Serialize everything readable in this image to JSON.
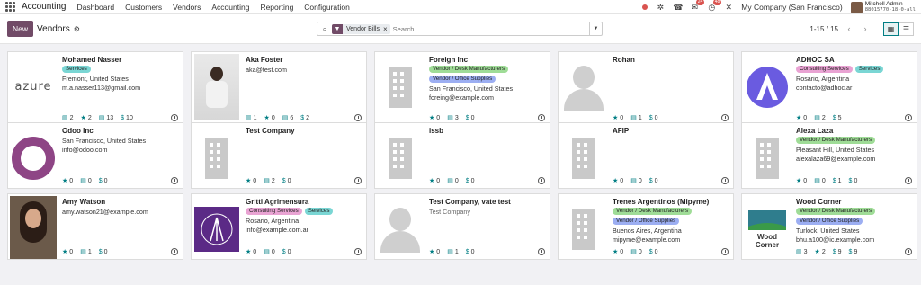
{
  "app": {
    "title": "Accounting"
  },
  "nav": [
    "Dashboard",
    "Customers",
    "Vendors",
    "Accounting",
    "Reporting",
    "Configuration"
  ],
  "systray": {
    "activity_count": "24",
    "chat_count": "48",
    "company": "My Company (San Francisco)",
    "user": "Mitchell Admin",
    "db": "88015770-18-0-all"
  },
  "control": {
    "new_label": "New",
    "breadcrumb": "Vendors",
    "facet": "Vendor Bills",
    "search_placeholder": "Search...",
    "pager": "1-15 / 15"
  },
  "colors": {
    "brand": "#714b67",
    "accent": "#017e84"
  },
  "cards": [
    {
      "name": "Mohamed Nasser",
      "tags": [
        {
          "t": "Services",
          "c": "services"
        }
      ],
      "lines": [
        "Fremont, United States",
        "m.a.nasser113@gmail.com"
      ],
      "stats": [
        [
          "▥",
          "2"
        ],
        [
          "★",
          "2"
        ],
        [
          "▤",
          "13"
        ],
        [
          "$",
          "10"
        ]
      ],
      "img": "azure"
    },
    {
      "name": "Aka Foster",
      "tags": [],
      "lines": [
        "aka@test.com"
      ],
      "stats": [
        [
          "▥",
          "1"
        ],
        [
          "★",
          "0"
        ],
        [
          "▤",
          "6"
        ],
        [
          "$",
          "2"
        ]
      ],
      "img": "photo"
    },
    {
      "name": "Foreign Inc",
      "tags": [
        {
          "t": "Vendor / Desk Manufacturers",
          "c": "desk"
        },
        {
          "t": "Vendor / Office Supplies",
          "c": "office"
        }
      ],
      "lines": [
        "San Francisco, United States",
        "foreing@example.com"
      ],
      "stats": [
        [
          "★",
          "0"
        ],
        [
          "▤",
          "3"
        ],
        [
          "$",
          "0"
        ]
      ],
      "img": "bld"
    },
    {
      "name": "Rohan",
      "tags": [],
      "lines": [],
      "stats": [
        [
          "★",
          "0"
        ],
        [
          "▤",
          "1"
        ],
        [
          "$",
          "0"
        ]
      ],
      "img": "person"
    },
    {
      "name": "ADHOC SA",
      "tags": [
        {
          "t": "Consulting Services",
          "c": "consult"
        },
        {
          "t": "Services",
          "c": "services"
        }
      ],
      "lines": [
        "Rosario, Argentina",
        "contacto@adhoc.ar"
      ],
      "stats": [
        [
          "★",
          "0"
        ],
        [
          "▤",
          "2"
        ],
        [
          "$",
          "5"
        ]
      ],
      "img": "adhoc"
    },
    {
      "name": "Odoo Inc",
      "tags": [],
      "lines": [
        "San Francisco, United States",
        "info@odoo.com"
      ],
      "stats": [
        [
          "★",
          "0"
        ],
        [
          "▤",
          "0"
        ],
        [
          "$",
          "0"
        ]
      ],
      "img": "odoo"
    },
    {
      "name": "Test Company",
      "tags": [],
      "lines": [],
      "stats": [
        [
          "★",
          "0"
        ],
        [
          "▤",
          "2"
        ],
        [
          "$",
          "0"
        ]
      ],
      "img": "bld"
    },
    {
      "name": "issb",
      "tags": [],
      "lines": [],
      "stats": [
        [
          "★",
          "0"
        ],
        [
          "▤",
          "0"
        ],
        [
          "$",
          "0"
        ]
      ],
      "img": "bld"
    },
    {
      "name": "AFIP",
      "tags": [],
      "lines": [],
      "stats": [
        [
          "★",
          "0"
        ],
        [
          "▤",
          "0"
        ],
        [
          "$",
          "0"
        ]
      ],
      "img": "bld"
    },
    {
      "name": "Alexa Laza",
      "tags": [
        {
          "t": "Vendor / Desk Manufacturers",
          "c": "desk"
        }
      ],
      "lines": [
        "Pleasant Hill, United States",
        "alexalaza69@example.com"
      ],
      "stats": [
        [
          "★",
          "0"
        ],
        [
          "▤",
          "0"
        ],
        [
          "$",
          "1"
        ],
        [
          "$",
          "0"
        ]
      ],
      "img": "bld"
    },
    {
      "name": "Amy Watson",
      "tags": [],
      "lines": [
        "amy.watson21@example.com"
      ],
      "stats": [
        [
          "★",
          "0"
        ],
        [
          "▤",
          "1"
        ],
        [
          "$",
          "0"
        ]
      ],
      "img": "photo2"
    },
    {
      "name": "Gritti Agrimensura",
      "tags": [
        {
          "t": "Consulting Services",
          "c": "consult"
        },
        {
          "t": "Services",
          "c": "services"
        }
      ],
      "lines": [
        "Rosario, Argentina",
        "info@example.com.ar"
      ],
      "stats": [
        [
          "★",
          "0"
        ],
        [
          "▤",
          "0"
        ],
        [
          "$",
          "0"
        ]
      ],
      "img": "gritti"
    },
    {
      "name": "Test Company, vate test",
      "tags": [],
      "lines": [
        "Test Company"
      ],
      "muted": true,
      "stats": [
        [
          "★",
          "0"
        ],
        [
          "▤",
          "1"
        ],
        [
          "$",
          "0"
        ]
      ],
      "img": "person"
    },
    {
      "name": "Trenes Argentinos (Mipyme)",
      "tags": [
        {
          "t": "Vendor / Desk Manufacturers",
          "c": "desk"
        },
        {
          "t": "Vendor / Office Supplies",
          "c": "office"
        }
      ],
      "lines": [
        "Buenos Aires, Argentina",
        "mipyme@example.com"
      ],
      "stats": [
        [
          "★",
          "0"
        ],
        [
          "▤",
          "0"
        ],
        [
          "$",
          "0"
        ]
      ],
      "img": "bld"
    },
    {
      "name": "Wood Corner",
      "tags": [
        {
          "t": "Vendor / Desk Manufacturers",
          "c": "desk"
        },
        {
          "t": "Vendor / Office Supplies",
          "c": "office"
        }
      ],
      "lines": [
        "Turlock, United States",
        "bhu.a100@ic.example.com"
      ],
      "stats": [
        [
          "▥",
          "3"
        ],
        [
          "★",
          "2"
        ],
        [
          "$",
          "9"
        ],
        [
          "$",
          "9"
        ]
      ],
      "img": "wood"
    }
  ]
}
